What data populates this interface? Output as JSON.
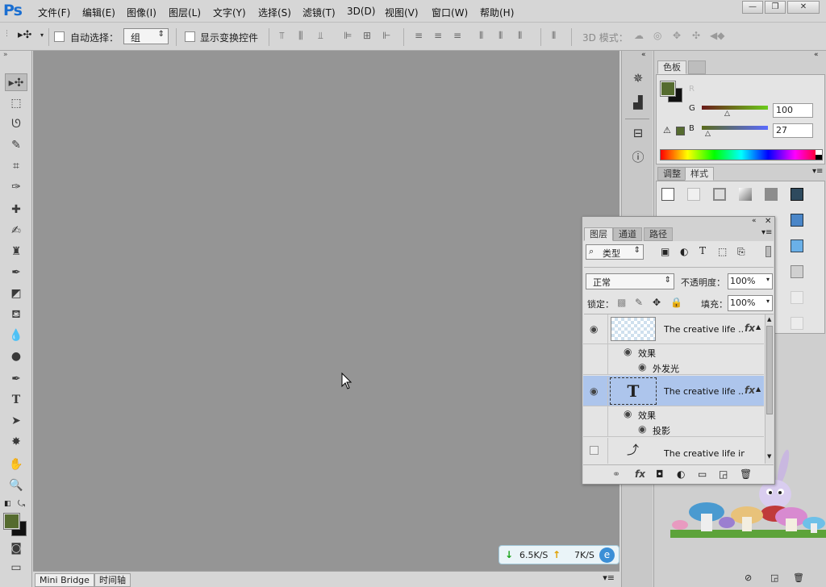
{
  "app": {
    "logo": "Ps"
  },
  "menu": [
    "文件(F)",
    "编辑(E)",
    "图像(I)",
    "图层(L)",
    "文字(Y)",
    "选择(S)",
    "滤镜(T)",
    "3D(D)",
    "视图(V)",
    "窗口(W)",
    "帮助(H)"
  ],
  "window_controls": {
    "minimize": "—",
    "restore": "❐",
    "close": "✕"
  },
  "options": {
    "auto_select_label": "自动选择：",
    "auto_select_value": "组",
    "show_transform_label": "显示变换控件",
    "mode_3d_label": "3D 模式："
  },
  "color_panel": {
    "tab": "色板",
    "g_label": "G",
    "g_value": "100",
    "b_label": "B",
    "b_value": "27",
    "r_label": "R",
    "foreground": "#556b2f",
    "background": "#111111"
  },
  "styles_panel": {
    "tabs": [
      "调整",
      "样式"
    ]
  },
  "layers_panel": {
    "tabs": [
      "图层",
      "通道",
      "路径"
    ],
    "filter_label": "类型",
    "blend_mode": "正常",
    "opacity_label": "不透明度：",
    "opacity_value": "100%",
    "lock_label": "锁定：",
    "fill_label": "填充：",
    "fill_value": "100%",
    "layers": [
      {
        "name": "The creative life ...",
        "fx": "fx",
        "effects_label": "效果",
        "effect": "外发光"
      },
      {
        "name": "The creative life ...",
        "fx": "fx",
        "effects_label": "效果",
        "effect": "投影"
      },
      {
        "name": "The creative life infi"
      }
    ],
    "text_layer_glyph": "T"
  },
  "bottom_tabs": [
    "Mini Bridge",
    "时间轴"
  ],
  "network": {
    "down": "6.5K/S",
    "up": "7K/S"
  }
}
